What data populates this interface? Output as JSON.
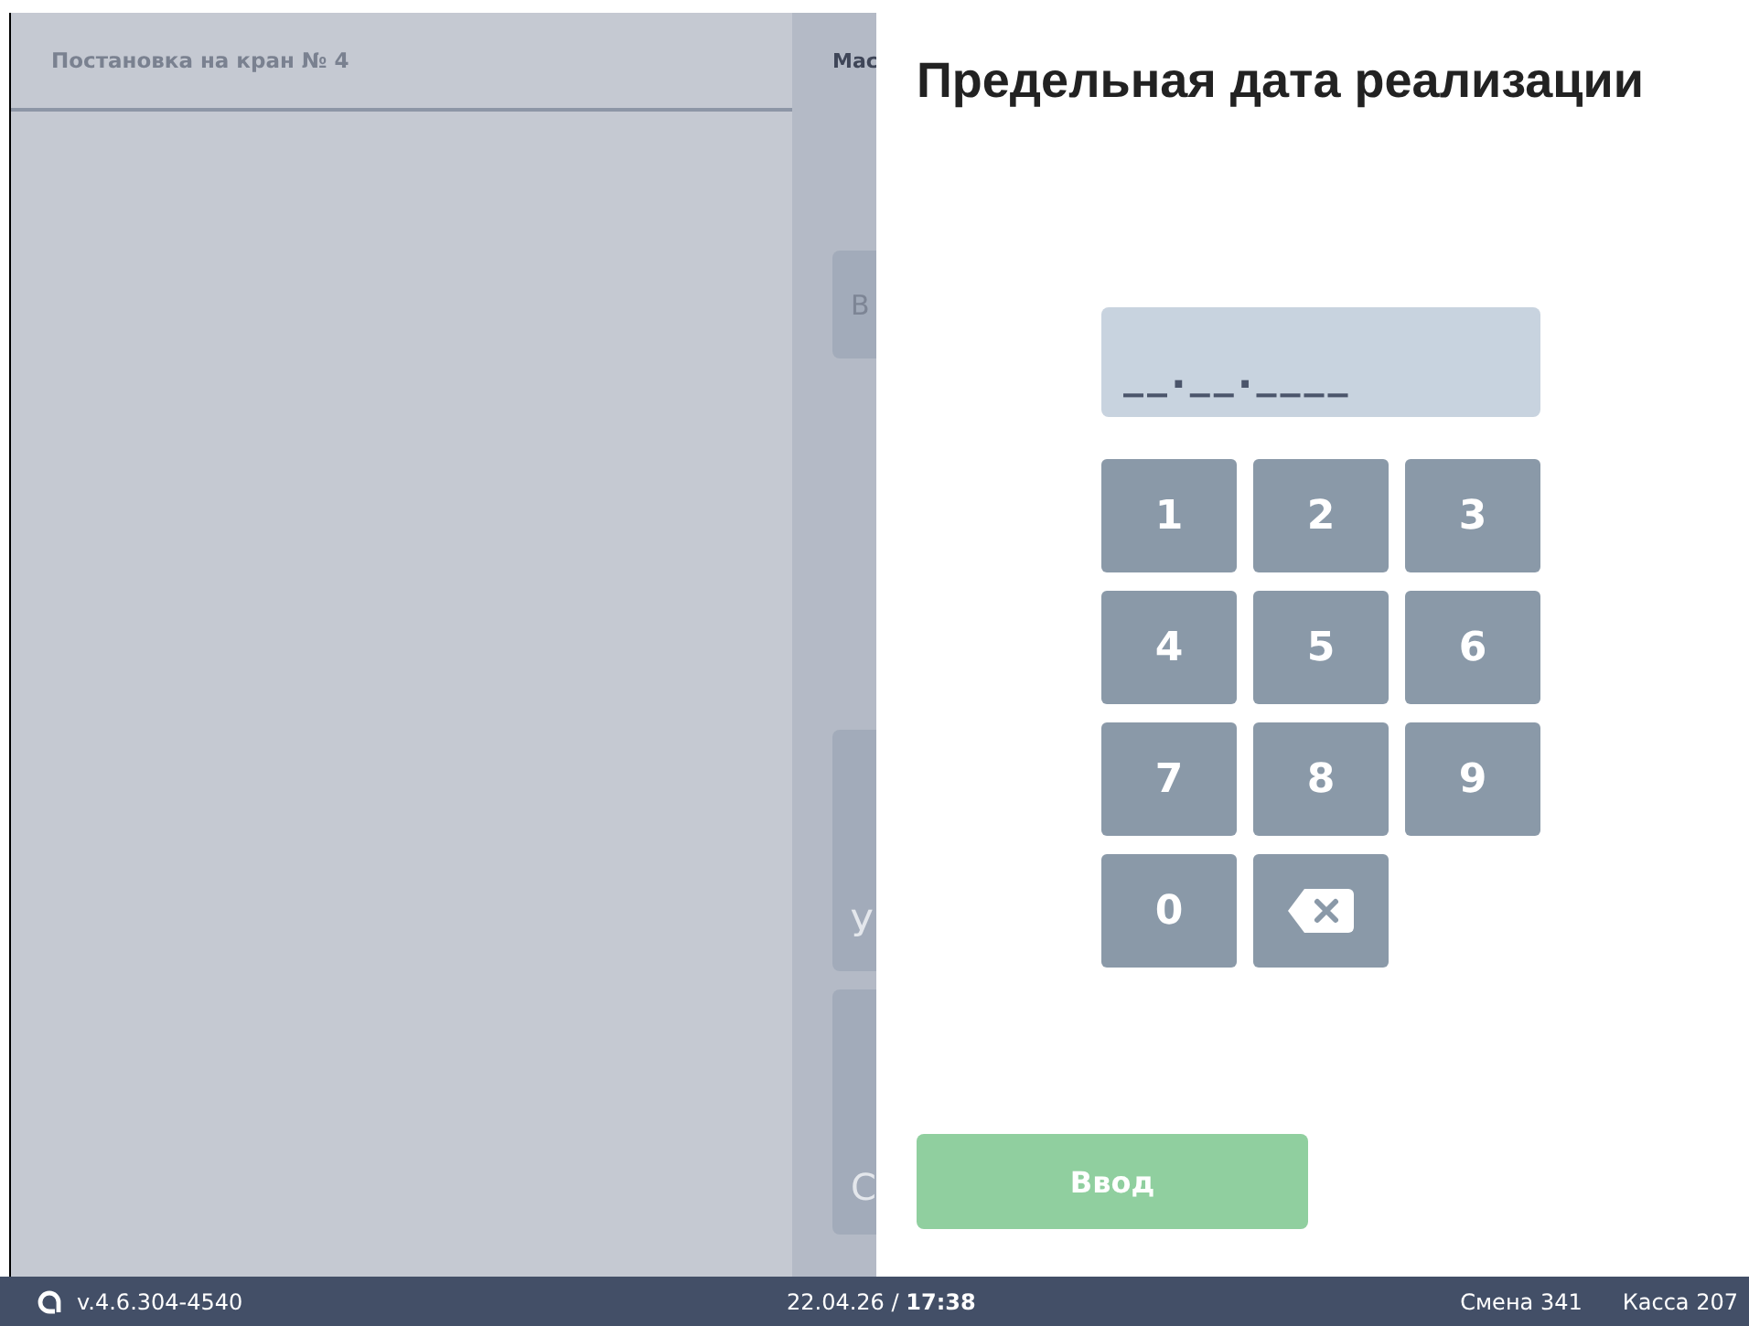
{
  "background": {
    "title": "Постановка на кран № 4",
    "column_header": "Мас",
    "cards": [
      {
        "label": "В"
      },
      {
        "label": "У"
      },
      {
        "label": "С"
      }
    ]
  },
  "dialog": {
    "title": "Предельная дата реализации",
    "date_field": {
      "placeholder": "__.__.____"
    },
    "keys": [
      {
        "kind": "digit",
        "label": "1"
      },
      {
        "kind": "digit",
        "label": "2"
      },
      {
        "kind": "digit",
        "label": "3"
      },
      {
        "kind": "digit",
        "label": "4"
      },
      {
        "kind": "digit",
        "label": "5"
      },
      {
        "kind": "digit",
        "label": "6"
      },
      {
        "kind": "digit",
        "label": "7"
      },
      {
        "kind": "digit",
        "label": "8"
      },
      {
        "kind": "digit",
        "label": "9"
      },
      {
        "kind": "digit",
        "label": "0"
      },
      {
        "kind": "backspace"
      }
    ],
    "enter_button": {
      "label": "Ввод",
      "disabled": true
    }
  },
  "status_bar": {
    "version": "v.4.6.304-4540",
    "date": "22.04.26",
    "separator": "/",
    "time": "17:38",
    "shift": "Смена 341",
    "register": "Касса 207"
  }
}
